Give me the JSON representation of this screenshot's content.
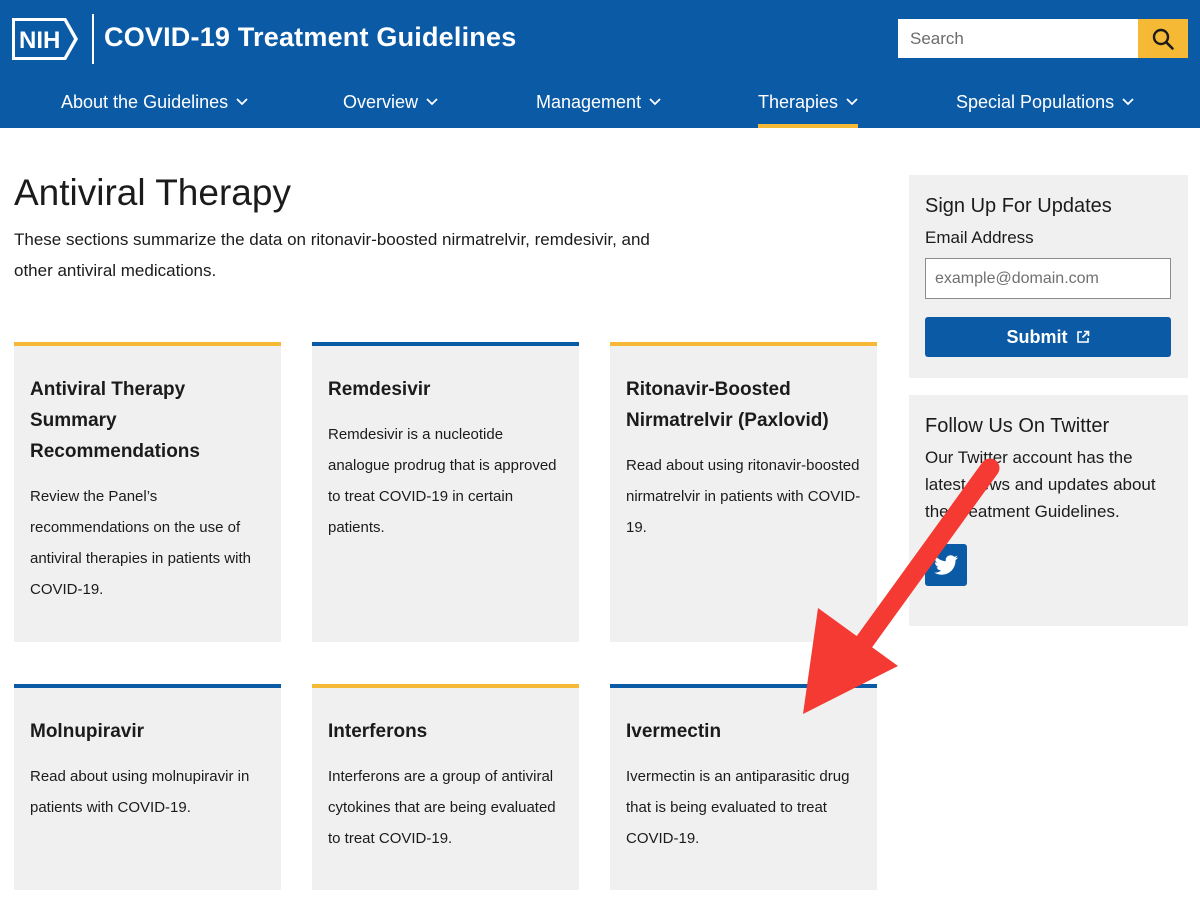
{
  "header": {
    "logo_text": "NIH",
    "site_title": "COVID-19 Treatment Guidelines",
    "search_placeholder": "Search",
    "brand_color": "#0b5aa6",
    "accent_color": "#f6b936"
  },
  "nav": {
    "items": [
      {
        "label": "About the Guidelines",
        "icon": "chevron-down-icon"
      },
      {
        "label": "Overview",
        "icon": "chevron-down-icon"
      },
      {
        "label": "Management",
        "icon": "chevron-down-icon"
      },
      {
        "label": "Therapies",
        "icon": "chevron-down-icon",
        "active": true
      },
      {
        "label": "Special Populations",
        "icon": "chevron-down-icon"
      }
    ]
  },
  "main": {
    "title": "Antiviral Therapy",
    "intro": "These sections summarize the data on ritonavir-boosted nirmatrelvir, remdesivir, and other antiviral medications.",
    "cards": [
      {
        "title": "Antiviral Therapy Summary Recommendations",
        "description": "Review the Panel’s recommendations on the use of antiviral therapies in patients with COVID-19.",
        "accent": "gold"
      },
      {
        "title": "Remdesivir",
        "description": "Remdesivir is a nucleotide analogue prodrug that is approved to treat COVID-19 in certain patients.",
        "accent": "blue"
      },
      {
        "title": "Ritonavir-Boosted Nirmatrelvir (Paxlovid)",
        "description": "Read about using ritonavir-boosted nirmatrelvir in patients with COVID-19.",
        "accent": "gold"
      },
      {
        "title": "Molnupiravir",
        "description": "Read about using molnupiravir in patients with COVID-19.",
        "accent": "blue"
      },
      {
        "title": "Interferons",
        "description": "Interferons are a group of antiviral cytokines that are being evaluated to treat COVID-19.",
        "accent": "gold"
      },
      {
        "title": "Ivermectin",
        "description": "Ivermectin is an antiparasitic drug that is being evaluated to treat COVID-19.",
        "accent": "blue"
      }
    ]
  },
  "sidebar": {
    "signup": {
      "heading": "Sign Up For Updates",
      "email_label": "Email Address",
      "email_placeholder": "example@domain.com",
      "submit_label": "Submit",
      "submit_icon": "external-link-icon"
    },
    "twitter": {
      "heading": "Follow Us On Twitter",
      "text": "Our Twitter account has the latest news and updates about the Treatment Guidelines.",
      "icon": "twitter-icon"
    }
  },
  "annotation": {
    "arrow_color": "#f43a32",
    "arrow_icon": "red-arrow-annotation"
  }
}
